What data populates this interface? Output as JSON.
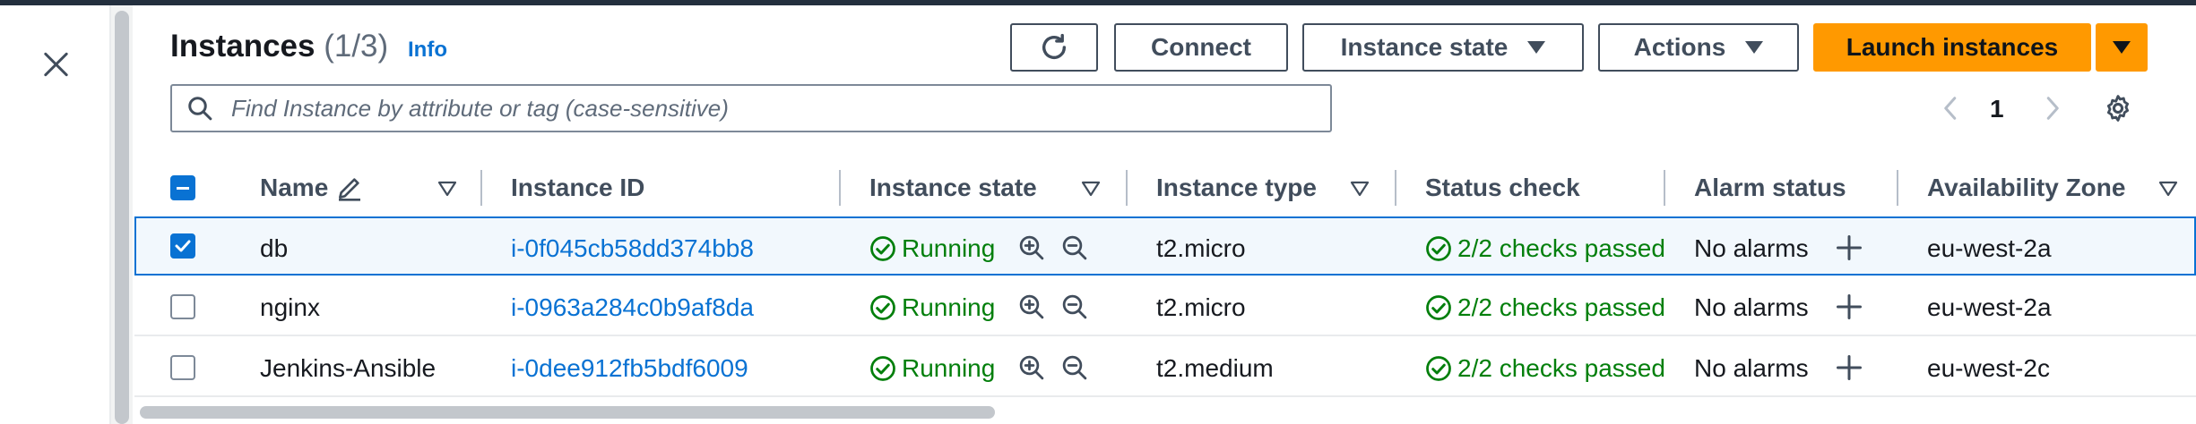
{
  "header": {
    "title": "Instances",
    "count": "(1/3)",
    "info_link": "Info"
  },
  "toolbar": {
    "connect_label": "Connect",
    "instance_state_label": "Instance state",
    "actions_label": "Actions",
    "launch_label": "Launch instances"
  },
  "search": {
    "placeholder": "Find Instance by attribute or tag (case-sensitive)"
  },
  "pagination": {
    "page": "1"
  },
  "table": {
    "columns": [
      "Name",
      "Instance ID",
      "Instance state",
      "Instance type",
      "Status check",
      "Alarm status",
      "Availability Zone"
    ],
    "rows": [
      {
        "selected": true,
        "name": "db",
        "instance_id": "i-0f045cb58dd374bb8",
        "state": "Running",
        "type": "t2.micro",
        "status_check": "2/2 checks passed",
        "alarm_status": "No alarms",
        "az": "eu-west-2a"
      },
      {
        "selected": false,
        "name": "nginx",
        "instance_id": "i-0963a284c0b9af8da",
        "state": "Running",
        "type": "t2.micro",
        "status_check": "2/2 checks passed",
        "alarm_status": "No alarms",
        "az": "eu-west-2a"
      },
      {
        "selected": false,
        "name": "Jenkins-Ansible",
        "instance_id": "i-0dee912fb5bdf6009",
        "state": "Running",
        "type": "t2.medium",
        "status_check": "2/2 checks passed",
        "alarm_status": "No alarms",
        "az": "eu-west-2c"
      }
    ]
  },
  "colors": {
    "primary_button": "#ff9900",
    "link": "#0972d3",
    "success": "#037f0c",
    "selection": "#0972d3"
  },
  "icons": {
    "close": "close-icon",
    "refresh": "refresh-icon",
    "search": "search-icon",
    "settings": "gear-icon",
    "edit": "pencil-icon",
    "running": "check-circle-icon",
    "zoom_in": "zoom-in-icon",
    "zoom_out": "zoom-out-icon",
    "add_alarm": "plus-icon"
  }
}
